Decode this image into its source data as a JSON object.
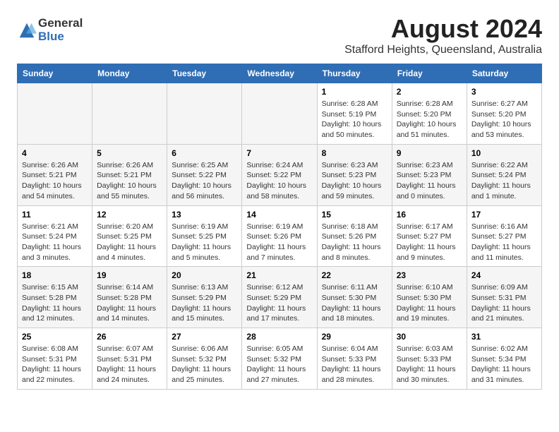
{
  "logo": {
    "general": "General",
    "blue": "Blue"
  },
  "title": "August 2024",
  "subtitle": "Stafford Heights, Queensland, Australia",
  "headers": [
    "Sunday",
    "Monday",
    "Tuesday",
    "Wednesday",
    "Thursday",
    "Friday",
    "Saturday"
  ],
  "weeks": [
    [
      {
        "day": "",
        "info": ""
      },
      {
        "day": "",
        "info": ""
      },
      {
        "day": "",
        "info": ""
      },
      {
        "day": "",
        "info": ""
      },
      {
        "day": "1",
        "info": "Sunrise: 6:28 AM\nSunset: 5:19 PM\nDaylight: 10 hours\nand 50 minutes."
      },
      {
        "day": "2",
        "info": "Sunrise: 6:28 AM\nSunset: 5:20 PM\nDaylight: 10 hours\nand 51 minutes."
      },
      {
        "day": "3",
        "info": "Sunrise: 6:27 AM\nSunset: 5:20 PM\nDaylight: 10 hours\nand 53 minutes."
      }
    ],
    [
      {
        "day": "4",
        "info": "Sunrise: 6:26 AM\nSunset: 5:21 PM\nDaylight: 10 hours\nand 54 minutes."
      },
      {
        "day": "5",
        "info": "Sunrise: 6:26 AM\nSunset: 5:21 PM\nDaylight: 10 hours\nand 55 minutes."
      },
      {
        "day": "6",
        "info": "Sunrise: 6:25 AM\nSunset: 5:22 PM\nDaylight: 10 hours\nand 56 minutes."
      },
      {
        "day": "7",
        "info": "Sunrise: 6:24 AM\nSunset: 5:22 PM\nDaylight: 10 hours\nand 58 minutes."
      },
      {
        "day": "8",
        "info": "Sunrise: 6:23 AM\nSunset: 5:23 PM\nDaylight: 10 hours\nand 59 minutes."
      },
      {
        "day": "9",
        "info": "Sunrise: 6:23 AM\nSunset: 5:23 PM\nDaylight: 11 hours\nand 0 minutes."
      },
      {
        "day": "10",
        "info": "Sunrise: 6:22 AM\nSunset: 5:24 PM\nDaylight: 11 hours\nand 1 minute."
      }
    ],
    [
      {
        "day": "11",
        "info": "Sunrise: 6:21 AM\nSunset: 5:24 PM\nDaylight: 11 hours\nand 3 minutes."
      },
      {
        "day": "12",
        "info": "Sunrise: 6:20 AM\nSunset: 5:25 PM\nDaylight: 11 hours\nand 4 minutes."
      },
      {
        "day": "13",
        "info": "Sunrise: 6:19 AM\nSunset: 5:25 PM\nDaylight: 11 hours\nand 5 minutes."
      },
      {
        "day": "14",
        "info": "Sunrise: 6:19 AM\nSunset: 5:26 PM\nDaylight: 11 hours\nand 7 minutes."
      },
      {
        "day": "15",
        "info": "Sunrise: 6:18 AM\nSunset: 5:26 PM\nDaylight: 11 hours\nand 8 minutes."
      },
      {
        "day": "16",
        "info": "Sunrise: 6:17 AM\nSunset: 5:27 PM\nDaylight: 11 hours\nand 9 minutes."
      },
      {
        "day": "17",
        "info": "Sunrise: 6:16 AM\nSunset: 5:27 PM\nDaylight: 11 hours\nand 11 minutes."
      }
    ],
    [
      {
        "day": "18",
        "info": "Sunrise: 6:15 AM\nSunset: 5:28 PM\nDaylight: 11 hours\nand 12 minutes."
      },
      {
        "day": "19",
        "info": "Sunrise: 6:14 AM\nSunset: 5:28 PM\nDaylight: 11 hours\nand 14 minutes."
      },
      {
        "day": "20",
        "info": "Sunrise: 6:13 AM\nSunset: 5:29 PM\nDaylight: 11 hours\nand 15 minutes."
      },
      {
        "day": "21",
        "info": "Sunrise: 6:12 AM\nSunset: 5:29 PM\nDaylight: 11 hours\nand 17 minutes."
      },
      {
        "day": "22",
        "info": "Sunrise: 6:11 AM\nSunset: 5:30 PM\nDaylight: 11 hours\nand 18 minutes."
      },
      {
        "day": "23",
        "info": "Sunrise: 6:10 AM\nSunset: 5:30 PM\nDaylight: 11 hours\nand 19 minutes."
      },
      {
        "day": "24",
        "info": "Sunrise: 6:09 AM\nSunset: 5:31 PM\nDaylight: 11 hours\nand 21 minutes."
      }
    ],
    [
      {
        "day": "25",
        "info": "Sunrise: 6:08 AM\nSunset: 5:31 PM\nDaylight: 11 hours\nand 22 minutes."
      },
      {
        "day": "26",
        "info": "Sunrise: 6:07 AM\nSunset: 5:31 PM\nDaylight: 11 hours\nand 24 minutes."
      },
      {
        "day": "27",
        "info": "Sunrise: 6:06 AM\nSunset: 5:32 PM\nDaylight: 11 hours\nand 25 minutes."
      },
      {
        "day": "28",
        "info": "Sunrise: 6:05 AM\nSunset: 5:32 PM\nDaylight: 11 hours\nand 27 minutes."
      },
      {
        "day": "29",
        "info": "Sunrise: 6:04 AM\nSunset: 5:33 PM\nDaylight: 11 hours\nand 28 minutes."
      },
      {
        "day": "30",
        "info": "Sunrise: 6:03 AM\nSunset: 5:33 PM\nDaylight: 11 hours\nand 30 minutes."
      },
      {
        "day": "31",
        "info": "Sunrise: 6:02 AM\nSunset: 5:34 PM\nDaylight: 11 hours\nand 31 minutes."
      }
    ]
  ]
}
